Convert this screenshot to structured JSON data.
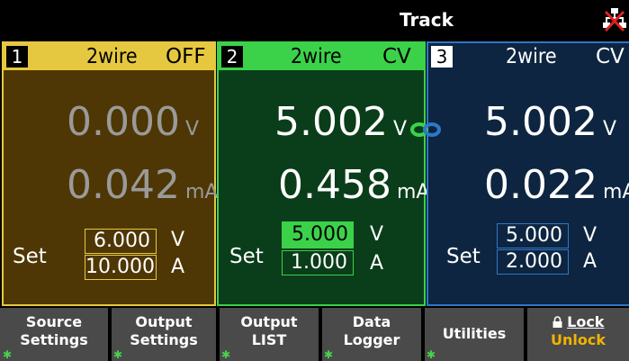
{
  "header": {
    "track_label": "Track",
    "network_icon": "network-disconnected-icon"
  },
  "channels": [
    {
      "number": "1",
      "sense": "2wire",
      "status": "OFF",
      "voltage": "0.000",
      "voltage_unit": "V",
      "current": "0.042",
      "current_unit": "mA",
      "set_label": "Set",
      "set_voltage": "6.000",
      "set_voltage_unit": "V",
      "set_current": "10.000",
      "set_current_unit": "A",
      "accent": "#e6c840"
    },
    {
      "number": "2",
      "sense": "2wire",
      "status": "CV",
      "voltage": "5.002",
      "voltage_unit": "V",
      "current": "0.458",
      "current_unit": "mA",
      "set_label": "Set",
      "set_voltage": "5.000",
      "set_voltage_unit": "V",
      "set_current": "1.000",
      "set_current_unit": "A",
      "accent": "#3bd24a"
    },
    {
      "number": "3",
      "sense": "2wire",
      "status": "CV",
      "voltage": "5.002",
      "voltage_unit": "V",
      "current": "0.022",
      "current_unit": "mA",
      "set_label": "Set",
      "set_voltage": "5.000",
      "set_voltage_unit": "V",
      "set_current": "2.000",
      "set_current_unit": "A",
      "accent": "#2e77c8"
    }
  ],
  "softkeys": {
    "source_settings": [
      "Source",
      "Settings"
    ],
    "output_settings": [
      "Output",
      "Settings"
    ],
    "output_list": [
      "Output",
      "LIST"
    ],
    "data_logger": [
      "Data",
      "Logger"
    ],
    "utilities": "Utilities",
    "lock": "Lock",
    "unlock": "Unlock"
  }
}
